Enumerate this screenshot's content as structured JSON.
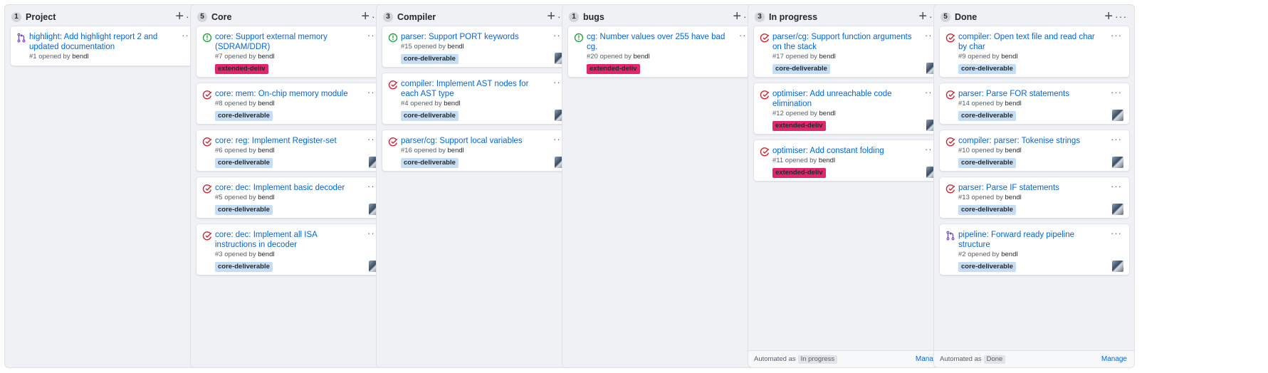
{
  "colors": {
    "open": "#28a745",
    "closed": "#cb2431",
    "pull_request": "#6f42c1",
    "link": "#0366d6",
    "label_core": "#c5def5",
    "label_extended": "#e3256c"
  },
  "opened_by_text": "opened by",
  "columns": [
    {
      "count": "1",
      "title": "Project",
      "cards": [
        {
          "icon": "pull-request-icon",
          "title": "highlight: Add highlight report 2 and updated documentation",
          "number": "#1",
          "author": "bendl",
          "label": "",
          "avatar": false
        }
      ]
    },
    {
      "count": "5",
      "title": "Core",
      "cards": [
        {
          "icon": "open-issue-icon",
          "title": "core: Support external memory (SDRAM/DDR)",
          "number": "#7",
          "author": "bendl",
          "label": "extended-deliv",
          "avatar": false
        },
        {
          "icon": "closed-issue-icon",
          "title": "core: mem: On-chip memory module",
          "number": "#8",
          "author": "bendl",
          "label": "core-deliverable",
          "avatar": false
        },
        {
          "icon": "closed-issue-icon",
          "title": "core: reg: Implement Register-set",
          "number": "#6",
          "author": "bendl",
          "label": "core-deliverable",
          "avatar": true
        },
        {
          "icon": "closed-issue-icon",
          "title": "core: dec: Implement basic decoder",
          "number": "#5",
          "author": "bendl",
          "label": "core-deliverable",
          "avatar": true
        },
        {
          "icon": "closed-issue-icon",
          "title": "core: dec: Implement all ISA instructions in decoder",
          "number": "#3",
          "author": "bendl",
          "label": "core-deliverable",
          "avatar": true
        }
      ]
    },
    {
      "count": "3",
      "title": "Compiler",
      "cards": [
        {
          "icon": "open-issue-icon",
          "title": "parser: Support PORT keywords",
          "number": "#15",
          "author": "bendl",
          "label": "core-deliverable",
          "avatar": true
        },
        {
          "icon": "closed-issue-icon",
          "title": "compiler: Implement AST nodes for each AST type",
          "number": "#4",
          "author": "bendl",
          "label": "core-deliverable",
          "avatar": true
        },
        {
          "icon": "closed-issue-icon",
          "title": "parser/cg: Support local variables",
          "number": "#16",
          "author": "bendl",
          "label": "core-deliverable",
          "avatar": true
        }
      ]
    },
    {
      "count": "1",
      "title": "bugs",
      "cards": [
        {
          "icon": "open-issue-icon",
          "title": "cg: Number values over 255 have bad cg.",
          "number": "#20",
          "author": "bendl",
          "label": "extended-deliv",
          "avatar": false
        }
      ]
    },
    {
      "count": "3",
      "title": "In progress",
      "automated_label": "Automated as",
      "automated_value": "In progress",
      "manage_label": "Manage",
      "cards": [
        {
          "icon": "closed-issue-icon",
          "title": "parser/cg: Support function arguments on the stack",
          "number": "#17",
          "author": "bendl",
          "label": "core-deliverable",
          "avatar": true
        },
        {
          "icon": "closed-issue-icon",
          "title": "optimiser: Add unreachable code elimination",
          "number": "#12",
          "author": "bendl",
          "label": "extended-deliv",
          "avatar": true
        },
        {
          "icon": "closed-issue-icon",
          "title": "optimiser: Add constant folding",
          "number": "#11",
          "author": "bendl",
          "label": "extended-deliv",
          "avatar": true
        }
      ]
    },
    {
      "count": "5",
      "title": "Done",
      "automated_label": "Automated as",
      "automated_value": "Done",
      "manage_label": "Manage",
      "cards": [
        {
          "icon": "closed-issue-icon",
          "title": "compiler: Open text file and read char by char",
          "number": "#9",
          "author": "bendl",
          "label": "core-deliverable",
          "avatar": false
        },
        {
          "icon": "closed-issue-icon",
          "title": "parser: Parse FOR statements",
          "number": "#14",
          "author": "bendl",
          "label": "core-deliverable",
          "avatar": true
        },
        {
          "icon": "closed-issue-icon",
          "title": "compiler: parser: Tokenise strings",
          "number": "#10",
          "author": "bendl",
          "label": "core-deliverable",
          "avatar": true
        },
        {
          "icon": "closed-issue-icon",
          "title": "parser: Parse IF statements",
          "number": "#13",
          "author": "bendl",
          "label": "core-deliverable",
          "avatar": true
        },
        {
          "icon": "pull-request-icon",
          "title": "pipeline: Forward ready pipeline structure",
          "number": "#2",
          "author": "bendl",
          "label": "core-deliverable",
          "avatar": true
        }
      ]
    }
  ]
}
